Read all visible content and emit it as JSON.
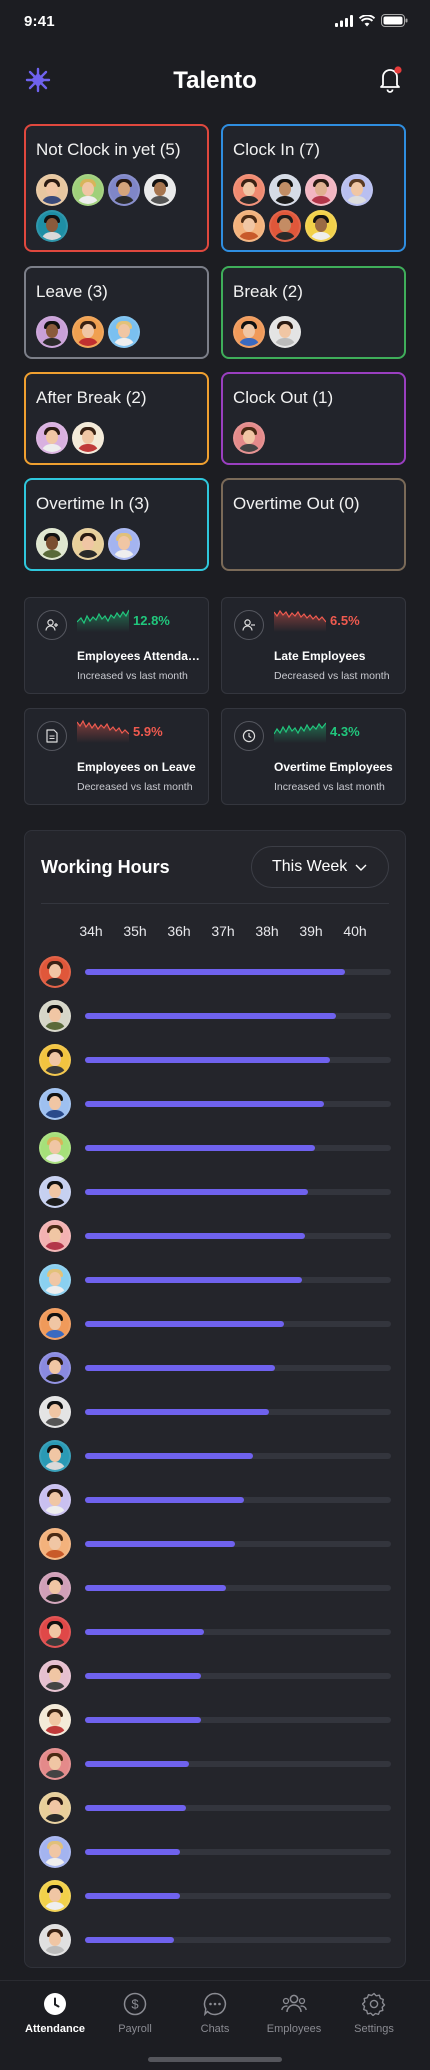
{
  "status_bar": {
    "time": "9:41"
  },
  "header": {
    "title": "Talento"
  },
  "colors": {
    "accent": "#6f62ee",
    "positive": "#21c77d",
    "negative": "#ef5a4f",
    "card_not_clocked": "#e0483e",
    "card_clock_in": "#2f8ee0",
    "card_leave": "#7c7f89",
    "card_break": "#3fae5a",
    "card_after_break": "#f0a030",
    "card_clock_out": "#9a3fc0",
    "card_overtime_in": "#2fc7dc",
    "card_overtime_out": "#7a6a58"
  },
  "attendance_cards": [
    {
      "title": "Not Clock in yet (5)",
      "icon": "none"
    },
    {
      "title": "Clock In (7)",
      "icon": "none"
    },
    {
      "title": "Leave (3)",
      "icon": "none"
    },
    {
      "title": "Break (2)",
      "icon": "none"
    },
    {
      "title": "After Break (2)",
      "icon": "none"
    },
    {
      "title": "Clock Out (1)",
      "icon": "none"
    },
    {
      "title": "Overtime In (3)",
      "icon": "none"
    },
    {
      "title": "Overtime Out (0)",
      "icon": "none"
    }
  ],
  "stats": [
    {
      "title": "Employees Attendance",
      "pct": "12.8%",
      "sub": "Increased vs last month",
      "trend": "up",
      "icon": "user-plus-icon"
    },
    {
      "title": "Late Employees",
      "pct": "6.5%",
      "sub": "Decreased vs last month",
      "trend": "down",
      "icon": "user-minus-icon"
    },
    {
      "title": "Employees on Leave",
      "pct": "5.9%",
      "sub": "Decreased vs last month",
      "trend": "down",
      "icon": "document-icon"
    },
    {
      "title": "Overtime Employees",
      "pct": "4.3%",
      "sub": "Increased vs last month",
      "trend": "up",
      "icon": "clock-icon"
    }
  ],
  "working_hours": {
    "title": "Working Hours",
    "period": "This Week",
    "ticks": [
      "34h",
      "35h",
      "36h",
      "37h",
      "38h",
      "39h",
      "40h"
    ],
    "progress": [
      0.85,
      0.82,
      0.8,
      0.78,
      0.75,
      0.73,
      0.72,
      0.71,
      0.65,
      0.62,
      0.6,
      0.55,
      0.52,
      0.49,
      0.46,
      0.39,
      0.38,
      0.38,
      0.34,
      0.33,
      0.31,
      0.31,
      0.29
    ]
  },
  "tabs": [
    {
      "label": "Attendance",
      "icon": "clock-icon",
      "active": true
    },
    {
      "label": "Payroll",
      "icon": "dollar-icon",
      "active": false
    },
    {
      "label": "Chats",
      "icon": "chat-icon",
      "active": false
    },
    {
      "label": "Employees",
      "icon": "people-icon",
      "active": false
    },
    {
      "label": "Settings",
      "icon": "gear-icon",
      "active": false
    }
  ]
}
